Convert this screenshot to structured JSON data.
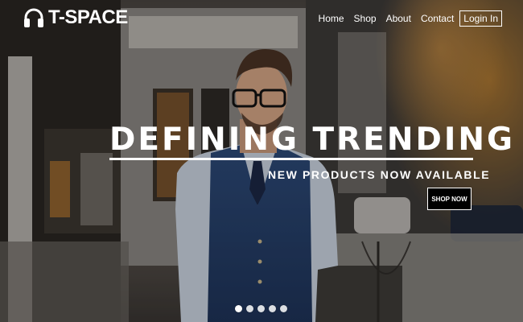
{
  "brand": {
    "name": "T-SPACE",
    "icon": "headphones-icon"
  },
  "nav": {
    "items": [
      {
        "label": "Home"
      },
      {
        "label": "Shop"
      },
      {
        "label": "About"
      },
      {
        "label": "Contact"
      }
    ],
    "login_label": "Login In"
  },
  "hero": {
    "headline": "DEFINING TRENDING",
    "subheadline": "NEW PRODUCTS NOW AVAILABLE",
    "cta_label": "SHOP NOW",
    "slides": {
      "count": 5,
      "active": 1
    }
  }
}
